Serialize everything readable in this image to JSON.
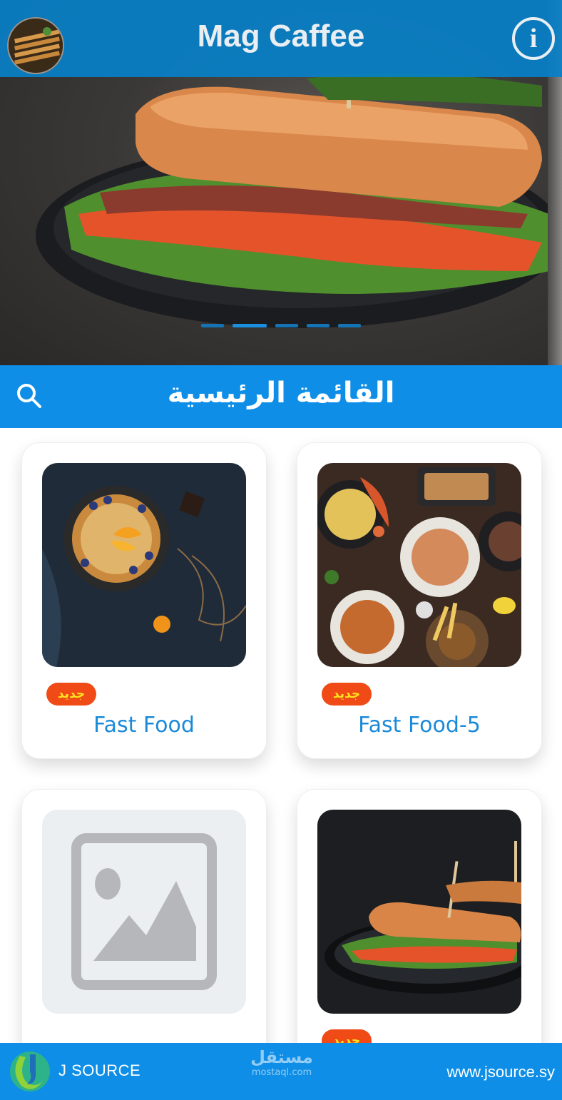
{
  "header": {
    "app_title": "Mag Caffee",
    "info_icon_glyph": "i"
  },
  "slider": {
    "slide_count": 5,
    "active_index": 1
  },
  "menu": {
    "title": "القائمة الرئيسية"
  },
  "categories": [
    {
      "name": "Fast Food",
      "badge": "جديد",
      "image": "pancake-skillet-photo"
    },
    {
      "name": "Fast Food-5",
      "badge": "جديد",
      "image": "seafood-platter-photo"
    },
    {
      "name": "",
      "badge": "",
      "image": "placeholder-image-icon"
    },
    {
      "name": "",
      "badge": "جديد",
      "image": "sandwich-photo"
    }
  ],
  "footer": {
    "brand": "J SOURCE",
    "watermark_ar": "مستقل",
    "watermark_en": "mostaql.com",
    "url": "www.jsource.sy"
  },
  "colors": {
    "primary": "#0e8ee6",
    "badge_bg": "#f04a16",
    "badge_text": "#ffe61c",
    "card_title": "#1a8ad8"
  }
}
